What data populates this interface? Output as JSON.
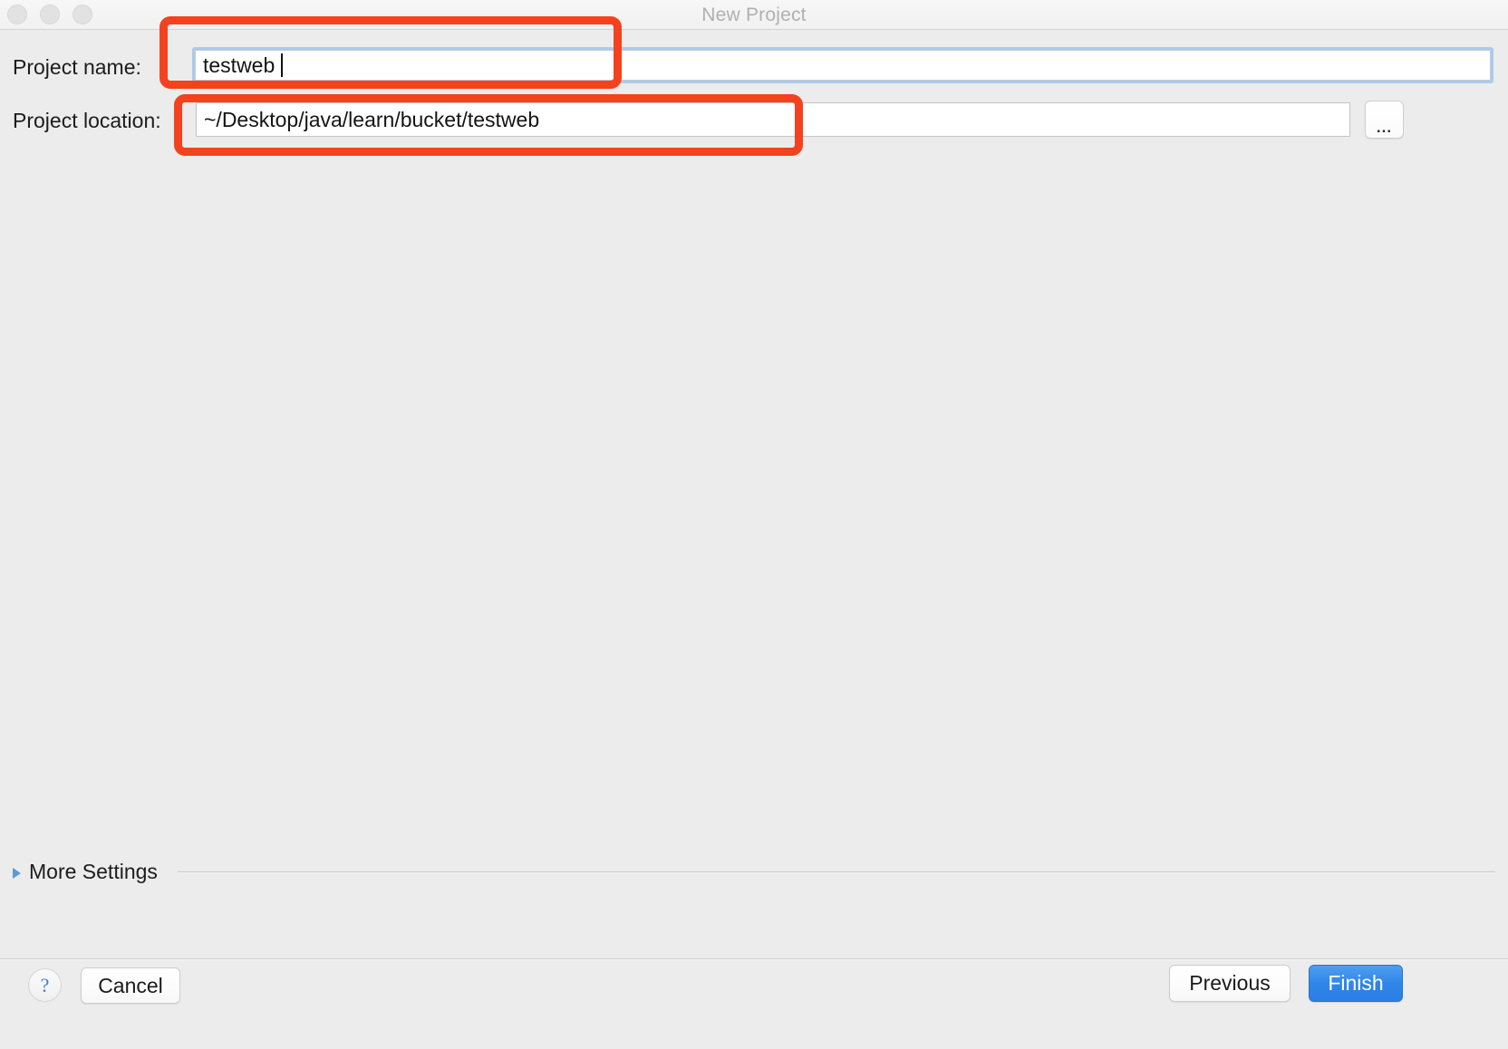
{
  "window": {
    "title": "New Project",
    "traffic_lights": [
      {
        "name": "close",
        "color": "#e2e2e2"
      },
      {
        "name": "minimize",
        "color": "#e2e2e2"
      },
      {
        "name": "zoom",
        "color": "#e2e2e2"
      }
    ]
  },
  "form": {
    "project_name": {
      "label": "Project name:",
      "value": "testweb",
      "placeholder": "",
      "focused": true
    },
    "project_location": {
      "label": "Project location:",
      "value": "~/Desktop/java/learn/bucket/testweb",
      "placeholder": "",
      "focused": false
    },
    "browse_button": {
      "label": "...",
      "title": "Browse"
    }
  },
  "more_settings": {
    "label": "More Settings",
    "expanded": false,
    "arrow_glyph": "▶"
  },
  "footer": {
    "help_label": "?",
    "cancel_label": "Cancel",
    "previous_label": "Previous",
    "finish_label": "Finish"
  },
  "annotations": [
    {
      "name": "project-name-highlight",
      "color": "#f4421e"
    },
    {
      "name": "project-location-highlight",
      "color": "#f4421e"
    }
  ],
  "colors": {
    "window_background": "#ececec",
    "titlebar": "#f4f4f4",
    "title_text": "#b0b0b0",
    "focus_ring": "#a8cbee",
    "accent_button": "#2f85e8",
    "annotation": "#f4421e",
    "help_glyph": "#3f7fc4",
    "disclosure_arrow": "#5a9ad5"
  }
}
